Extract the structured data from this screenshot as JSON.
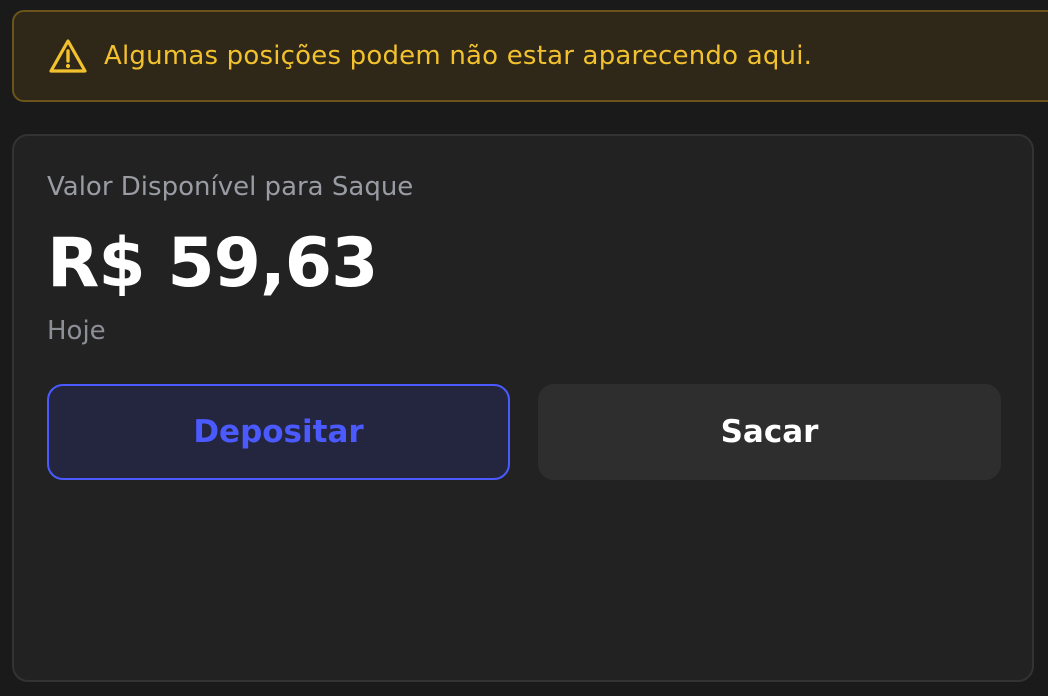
{
  "alert": {
    "icon": "warning-triangle-icon",
    "message": "Algumas posições podem não estar aparecendo aqui.",
    "color": "#f2c12e"
  },
  "balance": {
    "label": "Valor Disponível para Saque",
    "amount": "R$ 59,63",
    "date": "Hoje"
  },
  "actions": {
    "deposit_label": "Depositar",
    "withdraw_label": "Sacar",
    "accent_color": "#4a5aff"
  }
}
